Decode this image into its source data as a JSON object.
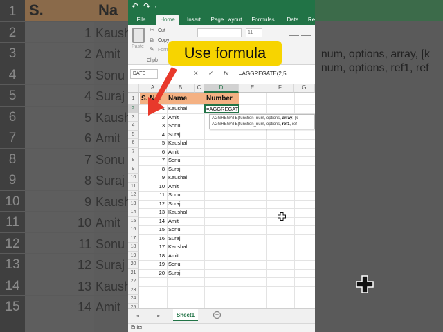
{
  "background": {
    "header": [
      "S.",
      "Na"
    ],
    "row_numbers": [
      "1",
      "2",
      "3",
      "4",
      "5",
      "6",
      "7",
      "8",
      "9",
      "10",
      "11",
      "12",
      "13",
      "14",
      "15"
    ],
    "nums": [
      "1",
      "2",
      "3",
      "4",
      "5",
      "6",
      "7",
      "8",
      "9",
      "10",
      "11",
      "12",
      "13",
      "14",
      "15"
    ],
    "names": [
      "Kaush",
      "Amit",
      "Sonu",
      "Suraj",
      "Kaush",
      "Amit",
      "Sonu",
      "Suraj",
      "Kaush",
      "Amit",
      "Sonu",
      "Suraj",
      "Kaush",
      "Amit",
      "Sonu"
    ],
    "tooltip_line1": "_num, options, array, [k",
    "tooltip_line2": "_num, options, ref1, ref"
  },
  "quick_access": {
    "save": "↶",
    "undo": "↷",
    "redo": "·"
  },
  "ribbon_tabs": [
    "File",
    "Home",
    "Insert",
    "Page Layout",
    "Formulas",
    "Data",
    "Re"
  ],
  "active_tab": "Home",
  "ribbon": {
    "paste": "Paste",
    "cut": "Cut",
    "copy": "Copy",
    "format": "Form",
    "clipboard": "Clipb",
    "font_size": "11"
  },
  "formula_bar": {
    "name_box": "DATE",
    "cancel_icon": "✕",
    "enter_icon": "✓",
    "fx_icon": "fx",
    "formula": "=AGGREGATE(2,5,"
  },
  "columns": [
    "A",
    "B",
    "C",
    "D",
    "E",
    "F",
    "G"
  ],
  "rows": [
    "1",
    "2",
    "3",
    "4",
    "5",
    "6",
    "7",
    "8",
    "9",
    "10",
    "11",
    "12",
    "13",
    "14",
    "15",
    "16",
    "17",
    "18",
    "19",
    "20",
    "21",
    "22",
    "23",
    "24",
    "25"
  ],
  "headers": {
    "sno": "S. No.",
    "name": "Name",
    "number": "Number"
  },
  "records": [
    {
      "n": "1",
      "name": "Kaushal"
    },
    {
      "n": "2",
      "name": "Amit"
    },
    {
      "n": "3",
      "name": "Sonu"
    },
    {
      "n": "4",
      "name": "Suraj"
    },
    {
      "n": "5",
      "name": "Kaushal"
    },
    {
      "n": "6",
      "name": "Amit"
    },
    {
      "n": "7",
      "name": "Sonu"
    },
    {
      "n": "8",
      "name": "Suraj"
    },
    {
      "n": "9",
      "name": "Kaushal"
    },
    {
      "n": "10",
      "name": "Amit"
    },
    {
      "n": "11",
      "name": "Sonu"
    },
    {
      "n": "12",
      "name": "Suraj"
    },
    {
      "n": "13",
      "name": "Kaushal"
    },
    {
      "n": "14",
      "name": "Amit"
    },
    {
      "n": "15",
      "name": "Sonu"
    },
    {
      "n": "16",
      "name": "Suraj"
    },
    {
      "n": "17",
      "name": "Kaushal"
    },
    {
      "n": "18",
      "name": "Amit"
    },
    {
      "n": "19",
      "name": "Sonu"
    },
    {
      "n": "20",
      "name": "Suraj"
    }
  ],
  "active_cell_text": "=AGGREGATE(2,5,",
  "tooltip": {
    "line1_pre": "AGGREGATE(function_num, options, ",
    "line1_bold": "array",
    "line1_post": ", [k",
    "line2_pre": "AGGREGATE(function_num, options, ",
    "line2_bold": "ref1",
    "line2_post": ", ref"
  },
  "sheet_tab": "Sheet1",
  "add_sheet": "+",
  "status": "Enter",
  "callout": "Use formula",
  "colors": {
    "excel_green": "#217346",
    "header_fill": "#f4b183",
    "callout": "#f7d400",
    "arrow": "#e8392b"
  }
}
